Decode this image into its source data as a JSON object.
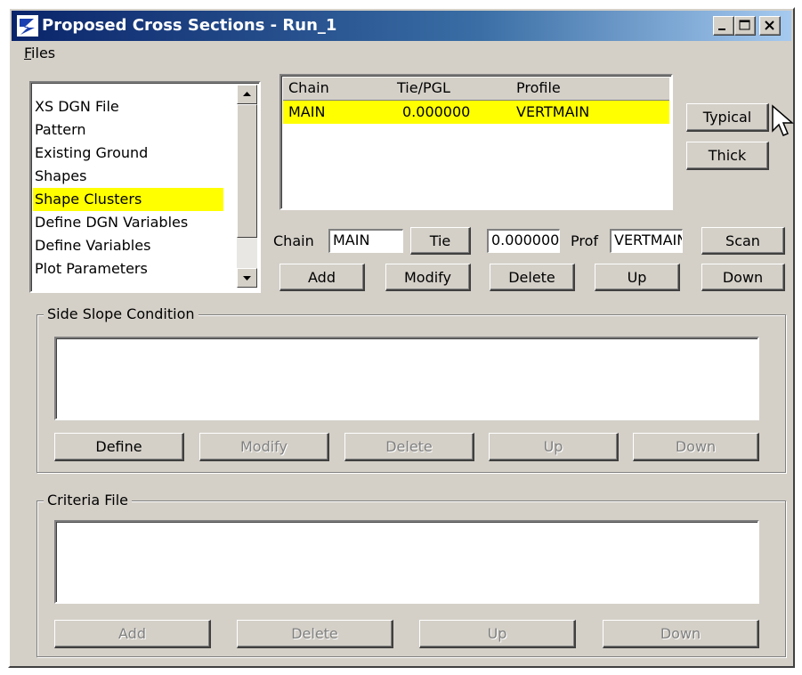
{
  "window": {
    "title": "Proposed Cross Sections - Run_1"
  },
  "menu": {
    "files": "Files"
  },
  "leftlist": {
    "items": [
      {
        "label": "XS DGN File",
        "selected": false
      },
      {
        "label": "Pattern",
        "selected": false
      },
      {
        "label": "Existing Ground",
        "selected": false
      },
      {
        "label": "Shapes",
        "selected": false
      },
      {
        "label": "Shape Clusters",
        "selected": true
      },
      {
        "label": "Define DGN Variables",
        "selected": false
      },
      {
        "label": "Define Variables",
        "selected": false
      },
      {
        "label": "Plot Parameters",
        "selected": false
      }
    ]
  },
  "chain_table": {
    "headers": [
      "Chain",
      "Tie/PGL",
      "Profile"
    ],
    "rows": [
      [
        "MAIN",
        "0.000000",
        "VERTMAIN"
      ]
    ]
  },
  "side_buttons": {
    "typical": "Typical",
    "thick": "Thick"
  },
  "editor": {
    "chain_label": "Chain",
    "chain_value": "MAIN",
    "tie_button": "Tie",
    "tie_value": "0.000000",
    "prof_label": "Prof",
    "prof_value": "VERTMAIN",
    "scan_button": "Scan"
  },
  "chain_actions": {
    "add": "Add",
    "modify": "Modify",
    "delete": "Delete",
    "up": "Up",
    "down": "Down"
  },
  "side_slope": {
    "title": "Side Slope Condition",
    "define": "Define",
    "modify": "Modify",
    "delete": "Delete",
    "up": "Up",
    "down": "Down"
  },
  "criteria": {
    "title": "Criteria File",
    "add": "Add",
    "delete": "Delete",
    "up": "Up",
    "down": "Down"
  },
  "colors": {
    "highlight": "#ffff00",
    "face": "#d4d0c8",
    "titlebar": "#0a246a"
  }
}
